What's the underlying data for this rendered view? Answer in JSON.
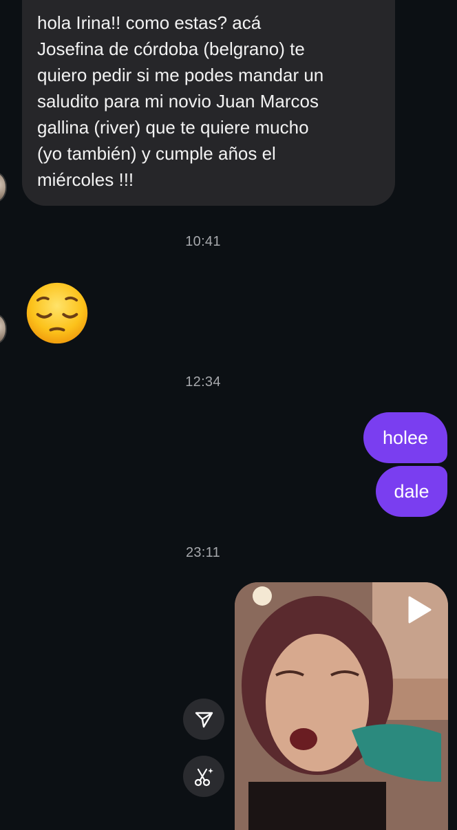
{
  "conversation": {
    "incoming_message": "hola Irina!! como estas? acá\nJosefina de córdoba (belgrano) te\nquiero pedir si me podes mandar un\nsaludito para mi novio Juan Marcos\ngallina (river) que te quiere mucho\n(yo también) y cumple años el\nmiércoles !!!",
    "timestamp_1": "10:41",
    "incoming_emoji_name": "pensive-face",
    "timestamp_2": "12:34",
    "outgoing_messages": [
      "holee",
      "dale"
    ],
    "timestamp_3": "23:11"
  },
  "media": {
    "type": "video",
    "play_icon": "play-icon"
  },
  "actions": {
    "share_icon": "send-icon",
    "ai_edit_icon": "scissors-sparkle-icon"
  },
  "colors": {
    "background": "#0c1014",
    "incoming_bubble": "#262629",
    "outgoing_bubble": "#7a3ef0",
    "timestamp": "#a7a9ad"
  }
}
